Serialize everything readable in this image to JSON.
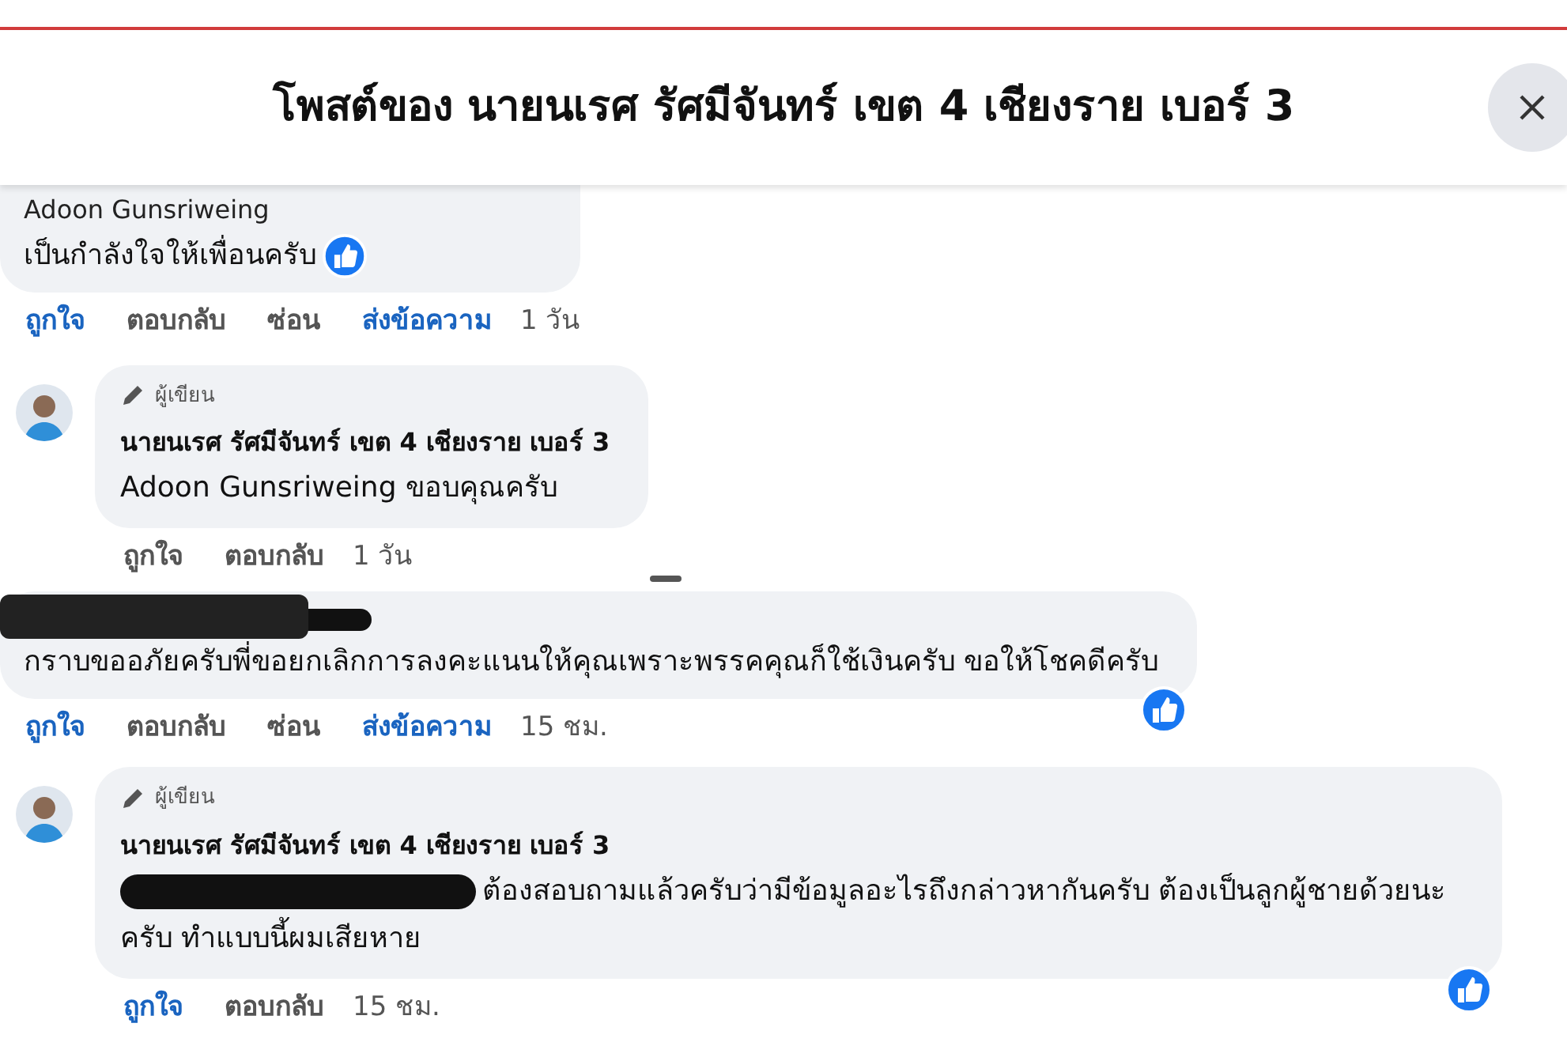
{
  "dialog": {
    "title": "โพสต์ของ นายนเรศ รัศมีจันทร์ เขต 4 เชียงราย เบอร์ 3"
  },
  "comments": [
    {
      "kind": "comment",
      "author": "Adoon Gunsriweing",
      "name_redacted": false,
      "text_redacted_prefix": false,
      "text": "เป็นกำลังใจให้เพื่อนครับ",
      "reaction": {
        "kind": "like",
        "inline": true
      },
      "actions": [
        {
          "label": "ถูกใจ",
          "highlighted": true
        },
        {
          "label": "ตอบกลับ",
          "highlighted": false
        },
        {
          "label": "ซ่อน",
          "highlighted": false
        },
        {
          "label": "ส่งข้อความ",
          "highlighted": true
        }
      ],
      "time": "1 วัน"
    },
    {
      "kind": "reply",
      "badge": "ผู้เขียน",
      "author": "นายนเรศ รัศมีจันทร์ เขต 4 เชียงราย เบอร์ 3",
      "name_redacted": false,
      "text_redacted_prefix": false,
      "text": "Adoon Gunsriweing ขอบคุณครับ",
      "actions": [
        {
          "label": "ถูกใจ",
          "highlighted": false
        },
        {
          "label": "ตอบกลับ",
          "highlighted": false
        }
      ],
      "time": "1 วัน"
    },
    {
      "kind": "comment",
      "name_redacted": true,
      "text_redacted_prefix": false,
      "text": "กราบขออภัยครับพี่ขอยกเลิกการลงคะแนนให้คุณเพราะพรรคคุณก็ใช้เงินครับ ขอให้โชคดีครับ",
      "reaction": {
        "kind": "like",
        "inline": false
      },
      "actions": [
        {
          "label": "ถูกใจ",
          "highlighted": true
        },
        {
          "label": "ตอบกลับ",
          "highlighted": false
        },
        {
          "label": "ซ่อน",
          "highlighted": false
        },
        {
          "label": "ส่งข้อความ",
          "highlighted": true
        }
      ],
      "time": "15 ชม."
    },
    {
      "kind": "reply",
      "badge": "ผู้เขียน",
      "author": "นายนเรศ รัศมีจันทร์ เขต 4 เชียงราย เบอร์ 3",
      "name_redacted": false,
      "text_redacted_prefix": true,
      "text": "ต้องสอบถามแล้วครับว่ามีข้อมูลอะไรถึงกล่าวหากันครับ ต้องเป็นลูกผู้ชายด้วยนะครับ ทำแบบนี้ผมเสียหาย",
      "reaction": {
        "kind": "like",
        "inline": false
      },
      "actions": [
        {
          "label": "ถูกใจ",
          "highlighted": true
        },
        {
          "label": "ตอบกลับ",
          "highlighted": false
        }
      ],
      "time": "15 ชม."
    }
  ]
}
